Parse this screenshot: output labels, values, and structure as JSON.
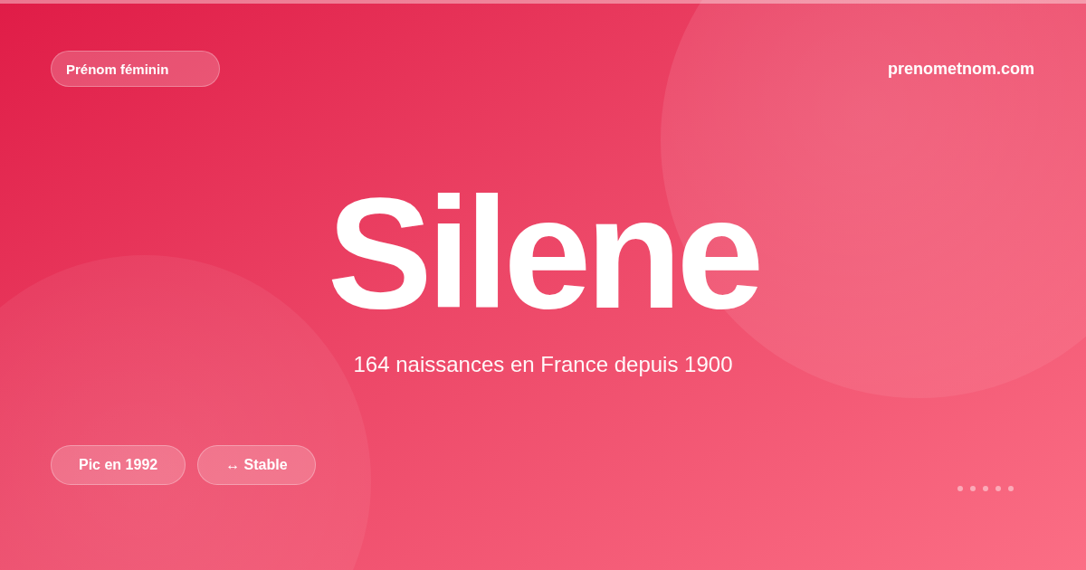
{
  "badge": {
    "label": "Prénom féminin"
  },
  "site": {
    "label": "prenometnom.com"
  },
  "name": {
    "title": "Silene",
    "subtitle": "164 naissances en France depuis 1900"
  },
  "tags": [
    {
      "label": "Pic en 1992"
    },
    {
      "label": "↔ Stable"
    }
  ]
}
